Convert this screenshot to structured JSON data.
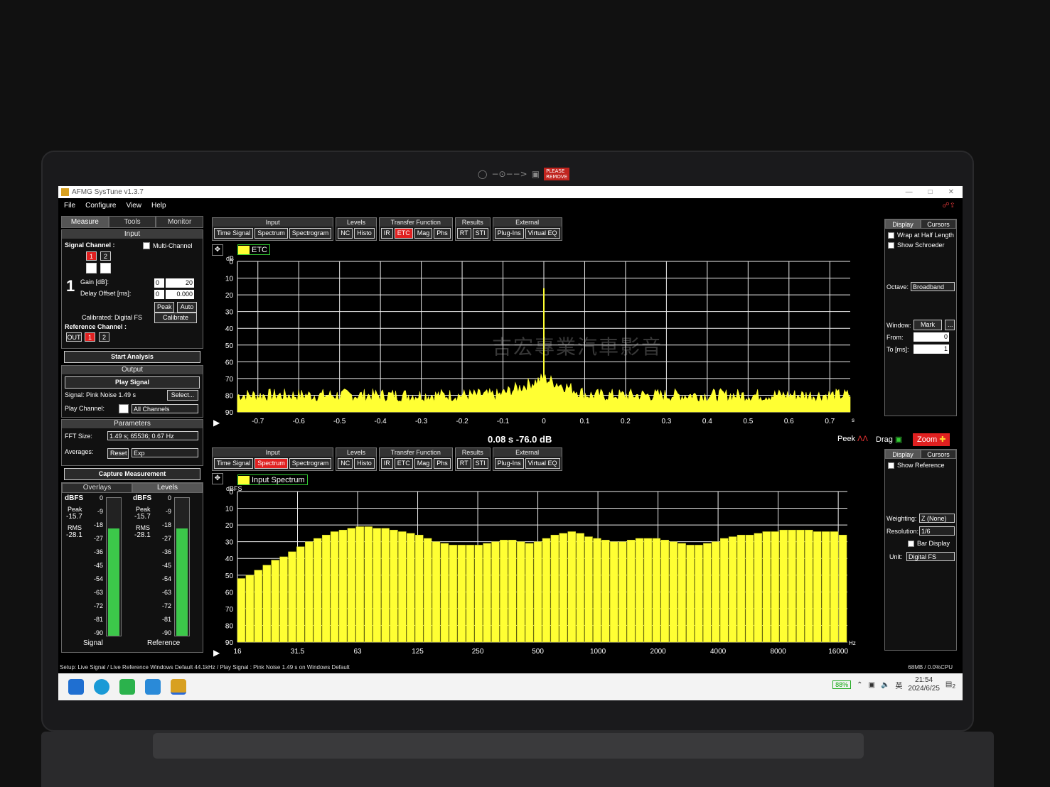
{
  "window": {
    "title": "AFMG SysTune v1.3.7"
  },
  "menu": [
    "File",
    "Configure",
    "View",
    "Help"
  ],
  "left_tabs": [
    "Measure",
    "Tools",
    "Monitor"
  ],
  "input": {
    "header": "Input",
    "signal_channel_label": "Signal Channel :",
    "multi_channel_label": "Multi-Channel",
    "channels": [
      "1",
      "2"
    ],
    "channel_number": "1",
    "gain_label": "Gain [dB]:",
    "gain_a": "0",
    "gain_b": "20",
    "delay_label": "Delay Offset [ms]:",
    "delay_a": "0",
    "delay_b": "0.000",
    "peak_btn": "Peak",
    "auto_btn": "Auto",
    "calibrated_label": "Calibrated: Digital FS",
    "calibrate_btn": "Calibrate",
    "reference_label": "Reference Channel :",
    "ref_out": "OUT",
    "start_btn": "Start Analysis"
  },
  "output": {
    "header": "Output",
    "play_btn": "Play Signal",
    "signal_label": "Signal: Pink Noise  1.49 s",
    "select_btn": "Select...",
    "play_channel_label": "Play Channel:",
    "play_channel_value": "All Channels"
  },
  "parameters": {
    "header": "Parameters",
    "fft_label": "FFT Size:",
    "fft_value": "1.49 s; 65536; 0.67 Hz",
    "averages_label": "Averages:",
    "reset_btn": "Reset",
    "avg_mode": "Exp",
    "capture_btn": "Capture Measurement"
  },
  "levels": {
    "tabs": [
      "Overlays",
      "Levels"
    ],
    "meters": [
      {
        "unit": "dBFS",
        "peak_label": "Peak",
        "peak": "-15.7",
        "rms_label": "RMS",
        "rms": "-28.1",
        "name": "Signal",
        "fill": 0.78
      },
      {
        "unit": "dBFS",
        "peak_label": "Peak",
        "peak": "-15.7",
        "rms_label": "RMS",
        "rms": "-28.1",
        "name": "Reference",
        "fill": 0.78
      }
    ],
    "scale": [
      "0",
      "-9",
      "-18",
      "-27",
      "-36",
      "-45",
      "-54",
      "-63",
      "-72",
      "-81",
      "-90"
    ]
  },
  "toolbar": {
    "groups": [
      {
        "title": "Input",
        "buttons": [
          "Time Signal",
          "Spectrum",
          "Spectrogram"
        ]
      },
      {
        "title": "Levels",
        "buttons": [
          "NC",
          "Histo"
        ]
      },
      {
        "title": "Transfer Function",
        "buttons": [
          "IR",
          "ETC",
          "Mag",
          "Phs"
        ]
      },
      {
        "title": "Results",
        "buttons": [
          "RT",
          "STI"
        ]
      },
      {
        "title": "External",
        "buttons": [
          "Plug-Ins",
          "Virtual EQ"
        ]
      }
    ],
    "top_active": "ETC",
    "bottom_active": "Spectrum"
  },
  "top_side": {
    "tabs": [
      "Display",
      "Cursors"
    ],
    "wrap_label": "Wrap at Half Length",
    "schroeder_label": "Show Schroeder",
    "octave_label": "Octave:",
    "octave_value": "Broadband",
    "window_label": "Window:",
    "window_value": "Mark",
    "window_more": "...",
    "from_label": "From:",
    "from_value": "0",
    "to_label": "To [ms]:",
    "to_value": "1"
  },
  "readout": {
    "value": "0.08 s   -76.0 dB",
    "peek": "Peek",
    "drag": "Drag",
    "zoom": "Zoom"
  },
  "bottom_side": {
    "tabs": [
      "Display",
      "Cursors"
    ],
    "show_ref_label": "Show Reference",
    "weighting_label": "Weighting:",
    "weighting_value": "Z (None)",
    "resolution_label": "Resolution:",
    "resolution_value": "1/6",
    "bar_display_label": "Bar Display",
    "unit_label": "Unit:",
    "unit_value": "Digital FS"
  },
  "status": {
    "left": "Setup: Live Signal / Live Reference Windows Default 44.1kHz / Play Signal : Pink Noise  1.49 s on Windows Default",
    "right": "68MB / 0.0%CPU"
  },
  "taskbar": {
    "battery": "88%",
    "lang": "英",
    "time": "21:54",
    "date": "2024/6/25",
    "notif": "2"
  },
  "watermark": "吉宏專業汽車影音",
  "chart_data": [
    {
      "type": "line",
      "legend": "ETC",
      "ylabel": "dB",
      "xlim": [
        -0.75,
        0.75
      ],
      "ylim": [
        -90,
        0
      ],
      "x_ticks": [
        "-0.7",
        "-0.6",
        "-0.5",
        "-0.4",
        "-0.3",
        "-0.2",
        "-0.1",
        "0",
        "0.1",
        "0.2",
        "0.3",
        "0.4",
        "0.5",
        "0.6",
        "0.7"
      ],
      "y_ticks": [
        "0",
        "-10",
        "-20",
        "-30",
        "-40",
        "-50",
        "-60",
        "-70",
        "-80",
        "-90"
      ],
      "x_unit": "s",
      "noise_floor": -81,
      "peak": {
        "x": 0,
        "y": -16
      },
      "color": "#ffff33"
    },
    {
      "type": "bar",
      "legend": "Input Spectrum",
      "ylabel": "dBFS",
      "x_unit": "Hz",
      "ylim": [
        -90,
        0
      ],
      "y_ticks": [
        "0",
        "-10",
        "-20",
        "-30",
        "-40",
        "-50",
        "-60",
        "-70",
        "-80",
        "-90"
      ],
      "x_ticks": [
        "16",
        "31.5",
        "63",
        "125",
        "250",
        "500",
        "1000",
        "2000",
        "4000",
        "8000",
        "16000"
      ],
      "values": [
        -52,
        -50,
        -47,
        -44,
        -41,
        -39,
        -36,
        -33,
        -30,
        -28,
        -26,
        -24,
        -23,
        -22,
        -21,
        -21,
        -22,
        -22,
        -23,
        -24,
        -25,
        -26,
        -28,
        -30,
        -31,
        -32,
        -32,
        -32,
        -32,
        -31,
        -30,
        -29,
        -29,
        -30,
        -31,
        -30,
        -28,
        -26,
        -25,
        -24,
        -25,
        -27,
        -28,
        -29,
        -30,
        -30,
        -29,
        -28,
        -28,
        -28,
        -29,
        -30,
        -31,
        -32,
        -32,
        -31,
        -30,
        -28,
        -27,
        -26,
        -26,
        -25,
        -24,
        -24,
        -23,
        -23,
        -23,
        -23,
        -24,
        -24,
        -24,
        -26
      ],
      "color": "#ffff33"
    }
  ]
}
